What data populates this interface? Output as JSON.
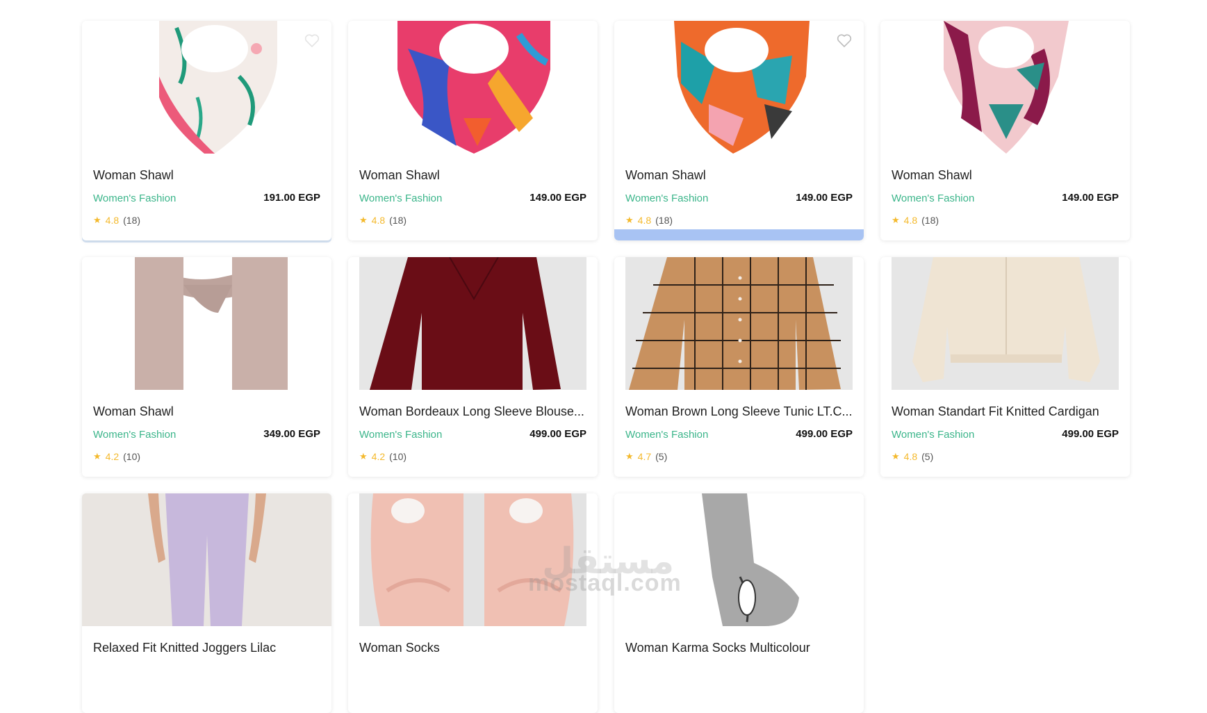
{
  "products": [
    {
      "title": "Woman Shawl",
      "category": "Women's Fashion",
      "price": "191.00 EGP",
      "rating": "4.8",
      "reviews": "(18)",
      "image": "shawl-floral-white"
    },
    {
      "title": "Woman Shawl",
      "category": "Women's Fashion",
      "price": "149.00 EGP",
      "rating": "4.8",
      "reviews": "(18)",
      "image": "shawl-colorful-pink"
    },
    {
      "title": "Woman Shawl",
      "category": "Women's Fashion",
      "price": "149.00 EGP",
      "rating": "4.8",
      "reviews": "(18)",
      "image": "shawl-geometric-orange"
    },
    {
      "title": "Woman Shawl",
      "category": "Women's Fashion",
      "price": "149.00 EGP",
      "rating": "4.8",
      "reviews": "(18)",
      "image": "shawl-pink-burgundy"
    },
    {
      "title": "Woman Shawl",
      "category": "Women's Fashion",
      "price": "349.00 EGP",
      "rating": "4.2",
      "reviews": "(10)",
      "image": "scarf-beige"
    },
    {
      "title": "Woman Bordeaux Long Sleeve Blouse...",
      "category": "Women's Fashion",
      "price": "499.00 EGP",
      "rating": "4.2",
      "reviews": "(10)",
      "image": "blouse-bordeaux"
    },
    {
      "title": "Woman Brown Long Sleeve Tunic LT.C...",
      "category": "Women's Fashion",
      "price": "499.00 EGP",
      "rating": "4.7",
      "reviews": "(5)",
      "image": "tunic-brown-check"
    },
    {
      "title": "Woman Standart Fit Knitted Cardigan",
      "category": "Women's Fashion",
      "price": "499.00 EGP",
      "rating": "4.8",
      "reviews": "(5)",
      "image": "cardigan-cream"
    },
    {
      "title": "Relaxed Fit Knitted Joggers Lilac",
      "image": "joggers-lilac"
    },
    {
      "title": "Woman Socks",
      "image": "socks-pink-fuzzy"
    },
    {
      "title": "Woman Karma Socks Multicolour",
      "image": "socks-gray-bunny"
    }
  ],
  "watermark": {
    "text": "mostaql.com",
    "arabic": "مستقل"
  },
  "colors": {
    "category": "#3bb58a",
    "star": "#f4b92c",
    "add_bar": "#a8c3f3"
  }
}
